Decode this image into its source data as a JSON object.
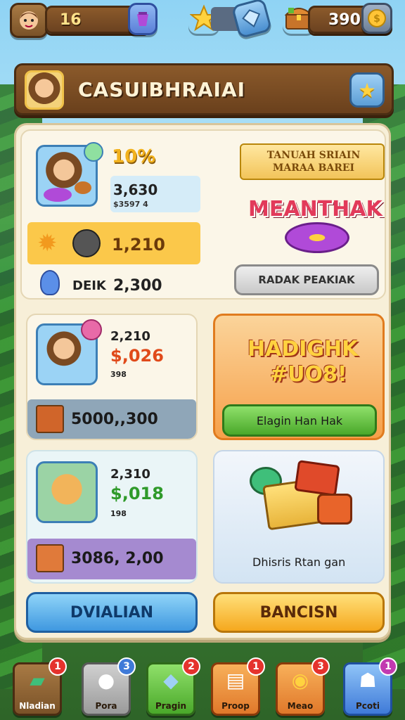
{
  "topbar": {
    "level": "16",
    "coins": "390",
    "icons": [
      "character-icon",
      "potion-icon",
      "star-icon",
      "gem-icon",
      "treasure-chest-icon",
      "coin-icon"
    ]
  },
  "title_banner": {
    "title": "CASUIBHRAIAI",
    "icon": "star-icon"
  },
  "offer_card": {
    "percent": "10%",
    "amount_main": "3,630",
    "amount_sub": "$3597 4",
    "reward_amount": "1,210",
    "bottom_label": "DEIK",
    "bottom_amount": "2,300",
    "ribbon_text": "TANUAH SRIAIN MARAA BAREI",
    "headline": "MEANTHAK",
    "action_label": "RADAK PEAKIAK"
  },
  "pack_card_1": {
    "value_top": "2,210",
    "price": "$,026",
    "small": "398",
    "amount": "5000,,300"
  },
  "promo_card": {
    "headline": "HADIGHK",
    "subline": "#UO8!",
    "button_label": "Elagin Han Hak"
  },
  "pack_card_2": {
    "value_top": "2,310",
    "price": "$,018",
    "small": "198",
    "amount": "3086, 2,00"
  },
  "treasure_card": {
    "caption": "Dhisris Rtan gan"
  },
  "buttons": {
    "left": "DVIALIAN",
    "right": "BANCISN"
  },
  "nav": [
    {
      "label": "Nladian",
      "badge": "1",
      "icon": "cards-icon"
    },
    {
      "label": "Pora",
      "badge": "3",
      "icon": "ghost-icon"
    },
    {
      "label": "Pragin",
      "badge": "2",
      "icon": "gem-icon"
    },
    {
      "label": "Proop",
      "badge": "1",
      "icon": "book-icon"
    },
    {
      "label": "Meao",
      "badge": "3",
      "icon": "coins-icon"
    },
    {
      "label": "Pcoti",
      "badge": "1",
      "icon": "robot-icon"
    }
  ],
  "colors": {
    "wood": "#6b4220",
    "panel": "#f7efd8",
    "orange": "#f6a04a",
    "green": "#5dbb3a",
    "blue": "#58b0ea",
    "yellow": "#ffc436",
    "badge_red": "#e5322d"
  }
}
